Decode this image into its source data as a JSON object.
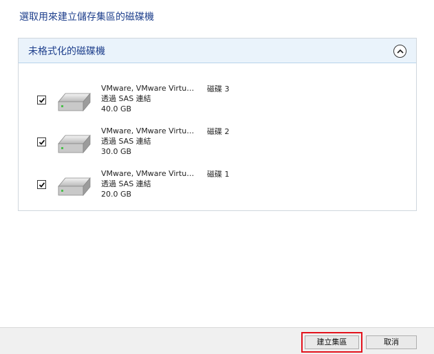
{
  "dialog": {
    "title": "選取用來建立儲存集區的磁碟機"
  },
  "group": {
    "title": "未格式化的磁碟機",
    "collapse_icon": "chevron-up-icon"
  },
  "disks": [
    {
      "name": "VMware, VMware Virtu…",
      "connection": "透過 SAS 連結",
      "size": "40.0 GB",
      "label": "磁碟 3",
      "checked": true
    },
    {
      "name": "VMware, VMware Virtu…",
      "connection": "透過 SAS 連結",
      "size": "30.0 GB",
      "label": "磁碟 2",
      "checked": true
    },
    {
      "name": "VMware, VMware Virtu…",
      "connection": "透過 SAS 連結",
      "size": "20.0 GB",
      "label": "磁碟 1",
      "checked": true
    }
  ],
  "footer": {
    "create_label": "建立集區",
    "cancel_label": "取消"
  },
  "colors": {
    "title": "#1e3f8c",
    "header_bg": "#eaf3fb",
    "highlight": "#e3111b"
  }
}
